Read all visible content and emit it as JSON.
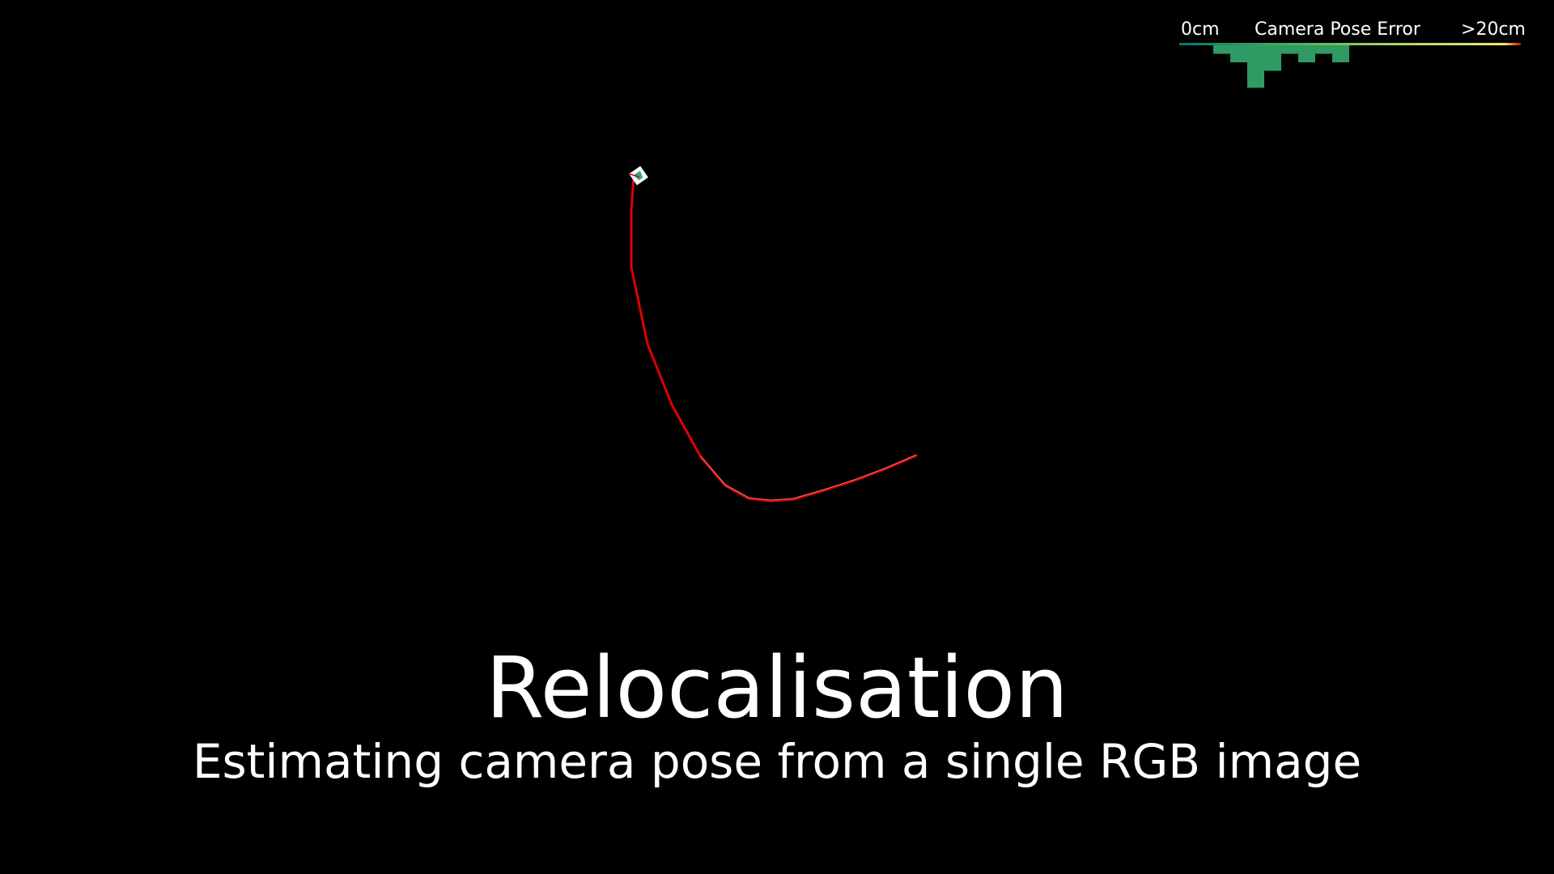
{
  "title": "Relocalisation",
  "subtitle": "Estimating camera pose from a single RGB image",
  "legend": {
    "min_label": "0cm",
    "title": "Camera Pose Error",
    "max_label": ">20cm"
  },
  "colors": {
    "background": "#000000",
    "text": "#ffffff",
    "trajectory": "#e00000",
    "trajectory_highlight": "#ffffff",
    "histogram": "#2f9a64",
    "camera_marker": "#ffffff"
  },
  "icons": {
    "camera_marker": "camera-frustum-icon"
  },
  "chart_data": {
    "type": "bar",
    "xlabel": "Camera Pose Error",
    "x_range_label": [
      "0cm",
      ">20cm"
    ],
    "x_range_cm": [
      0,
      20
    ],
    "bin_width_cm": 1,
    "values": [
      0,
      0,
      1,
      2,
      5,
      3,
      1,
      2,
      1,
      2,
      0,
      0,
      0,
      0,
      0,
      0,
      0,
      0,
      0,
      0
    ],
    "colorbar_stops": [
      "#007a6e",
      "#2f9a64",
      "#5fb85a",
      "#a6d26a",
      "#f0e870",
      "#e00000"
    ]
  }
}
